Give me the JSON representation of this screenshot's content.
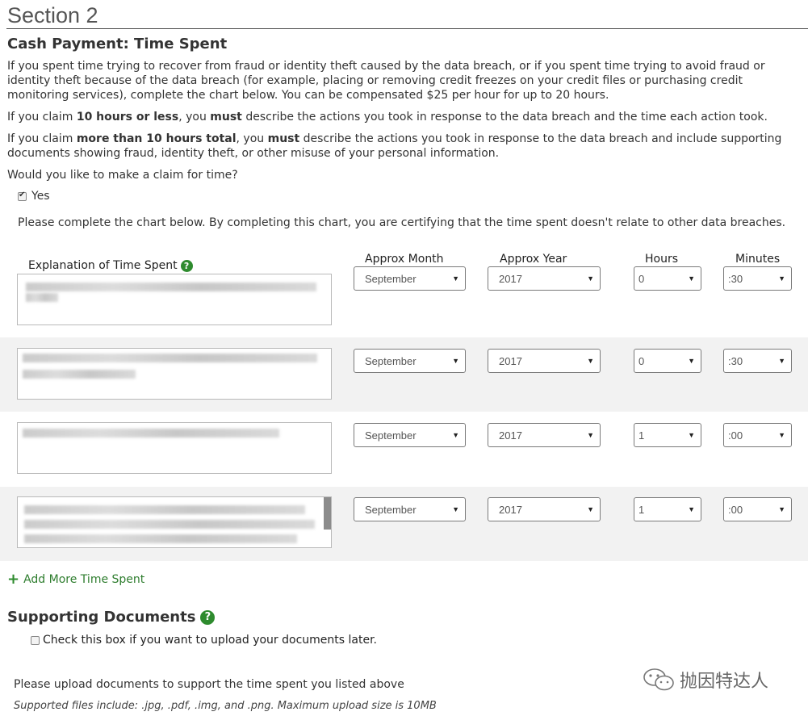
{
  "section": {
    "title": "Section 2",
    "subtitle": "Cash Payment: Time Spent"
  },
  "paragraphs": {
    "p1": "If you spent time trying to recover from fraud or identity theft caused by the data breach, or if you spent time trying to avoid fraud or identity theft because of the data breach (for example, placing or removing credit freezes on your credit files or purchasing credit monitoring services), complete the chart below. You can be compensated $25 per hour for up to 20 hours.",
    "p2_a": "If you claim ",
    "p2_b": "10 hours or less",
    "p2_c": ", you ",
    "p2_d": "must",
    "p2_e": " describe the actions you took in response to the data breach and the time each action took.",
    "p3_a": "If you claim ",
    "p3_b": "more than 10 hours total",
    "p3_c": ", you ",
    "p3_d": "must",
    "p3_e": " describe the actions you took in response to the data breach and include supporting documents showing fraud, identity theft, or other misuse of your personal information.",
    "question": "Would you like to make a claim for time?",
    "yes_label": "Yes",
    "instructions": "Please complete the chart below. By completing this chart, you are certifying that the time spent doesn't relate to other data breaches."
  },
  "columns": {
    "explanation": "Explanation of Time Spent",
    "month": "Approx Month",
    "year": "Approx Year",
    "hours": "Hours",
    "minutes": "Minutes",
    "help_glyph": "?"
  },
  "rows": [
    {
      "month": "September",
      "year": "2017",
      "hours": "0",
      "minutes": ":30"
    },
    {
      "month": "September",
      "year": "2017",
      "hours": "0",
      "minutes": ":30"
    },
    {
      "month": "September",
      "year": "2017",
      "hours": "1",
      "minutes": ":00"
    },
    {
      "month": "September",
      "year": "2017",
      "hours": "1",
      "minutes": ":00"
    }
  ],
  "add_more": "Add More Time Spent",
  "supporting": {
    "title": "Supporting Documents",
    "later_label": "Check this box if you want to upload your documents later.",
    "upload_note": "Please upload documents to support the time spent you listed above",
    "file_note": "Supported files include: .jpg, .pdf, .img, and .png. Maximum upload size is 10MB"
  },
  "watermark": "抛因特达人",
  "icons": {
    "checkbox_checked": "check-icon",
    "caret": "chevron-down-icon",
    "help": "help-icon",
    "plus": "plus-icon",
    "watermark": "wechat-logo-icon"
  },
  "colors": {
    "accent_green": "#2e8b2e",
    "row_shade": "#f2f2f2"
  }
}
